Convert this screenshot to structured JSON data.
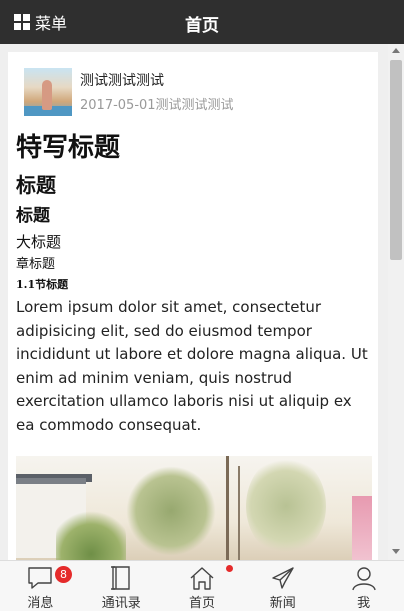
{
  "topbar": {
    "menu_label": "菜单",
    "title": "首页"
  },
  "article": {
    "author_name": "测试测试测试",
    "meta": "2017-05-01测试测试测试",
    "h1": "特写标题",
    "h2": "标题",
    "h3": "标题",
    "h4": "大标题",
    "h5": "章标题",
    "h6": "1.1节标题",
    "paragraph": "Lorem ipsum dolor sit amet, consectetur adipisicing elit, sed do eiusmod tempor incididunt ut labore et dolore magna aliqua. Ut enim ad minim veniam, quis nostrud exercitation ullamco laboris nisi ut aliquip ex ea commodo consequat."
  },
  "tabbar": {
    "items": [
      {
        "label": "消息",
        "icon": "message-icon",
        "badge": "8"
      },
      {
        "label": "通讯录",
        "icon": "contacts-book-icon"
      },
      {
        "label": "首页",
        "icon": "home-icon"
      },
      {
        "label": "新闻",
        "icon": "paper-plane-icon",
        "dot": true
      },
      {
        "label": "我",
        "icon": "user-icon"
      }
    ]
  },
  "colors": {
    "topbar_bg": "#2f2f2f",
    "badge": "#e52b2b",
    "meta_text": "#999999"
  }
}
